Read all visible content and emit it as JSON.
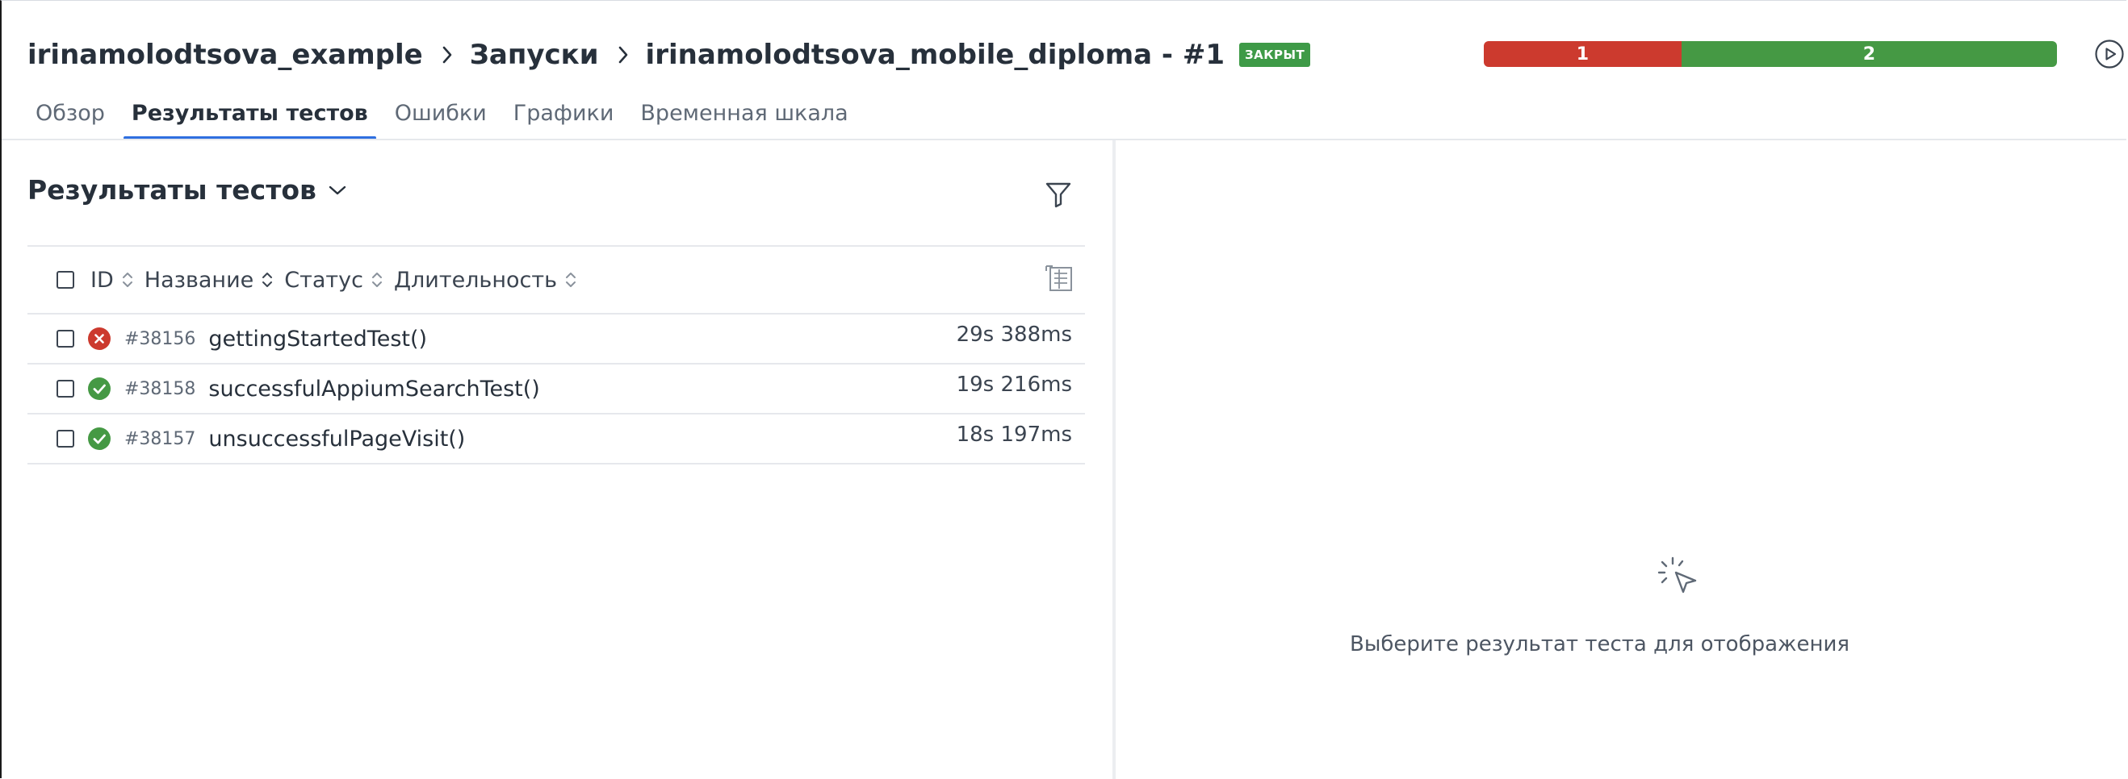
{
  "breadcrumb": {
    "project": "irinamolodtsova_example",
    "launches": "Запуски",
    "launch": "irinamolodtsova_mobile_diploma - #1",
    "status_badge": "ЗАКРЫТ"
  },
  "stats": {
    "failed": "1",
    "passed": "2",
    "colors": {
      "failed": "#cc3a2e",
      "passed": "#459944"
    }
  },
  "tabs": [
    {
      "label": "Обзор",
      "active": false
    },
    {
      "label": "Результаты тестов",
      "active": true
    },
    {
      "label": "Ошибки",
      "active": false
    },
    {
      "label": "Графики",
      "active": false
    },
    {
      "label": "Временная шкала",
      "active": false
    }
  ],
  "results": {
    "title": "Результаты тестов",
    "columns": {
      "id": "ID",
      "name": "Название",
      "status": "Статус",
      "duration": "Длительность"
    },
    "rows": [
      {
        "status": "failed",
        "id": "#38156",
        "name": "gettingStartedTest()",
        "duration": "29s 388ms"
      },
      {
        "status": "passed",
        "id": "#38158",
        "name": "successfulAppiumSearchTest()",
        "duration": "19s 216ms"
      },
      {
        "status": "passed",
        "id": "#38157",
        "name": "unsuccessfulPageVisit()",
        "duration": "18s 197ms"
      }
    ]
  },
  "detail": {
    "empty_text": "Выберите результат теста для отображения"
  },
  "icons": {
    "play": "play-circle-icon",
    "filter": "filter-icon",
    "settings": "column-settings-icon",
    "failed": "failed-status-icon",
    "passed": "passed-status-icon",
    "empty": "pointer-click-icon"
  }
}
